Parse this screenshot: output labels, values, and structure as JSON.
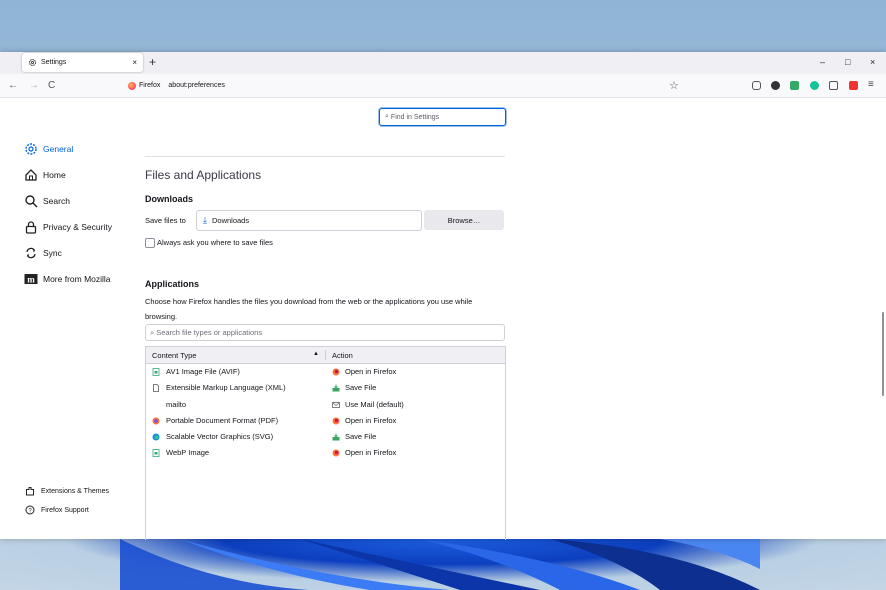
{
  "browser": {
    "tab_title": "Settings",
    "tab_close": "×",
    "new_tab": "+",
    "window_controls": {
      "minimize": "–",
      "maximize": "□",
      "close": "×"
    },
    "nav": {
      "back": "←",
      "forward": "→",
      "reload": "C"
    },
    "url_brand": "Firefox",
    "url": "about:preferences",
    "bookmark_star": "☆",
    "menu": "≡"
  },
  "search": {
    "placeholder": "Find in Settings"
  },
  "sidebar": {
    "items": [
      {
        "label": "General",
        "icon": "gear-icon",
        "active": true
      },
      {
        "label": "Home",
        "icon": "home-icon"
      },
      {
        "label": "Search",
        "icon": "search-icon"
      },
      {
        "label": "Privacy & Security",
        "icon": "lock-icon"
      },
      {
        "label": "Sync",
        "icon": "sync-icon"
      },
      {
        "label": "More from Mozilla",
        "icon": "mozilla-icon"
      }
    ],
    "footer": [
      {
        "label": "Extensions & Themes",
        "icon": "puzzle-icon"
      },
      {
        "label": "Firefox Support",
        "icon": "help-icon"
      }
    ]
  },
  "main": {
    "section_title": "Files and Applications",
    "downloads": {
      "heading": "Downloads",
      "save_label": "Save files to",
      "folder": "Downloads",
      "browse_label": "Browse…",
      "always_ask_label": "Always ask you where to save files",
      "always_ask_checked": false
    },
    "applications": {
      "heading": "Applications",
      "description": "Choose how Firefox handles the files you download from the web or the applications you use while browsing.",
      "search_placeholder": "Search file types or applications",
      "columns": [
        "Content Type",
        "Action"
      ],
      "rows": [
        {
          "type": "AV1 Image File (AVIF)",
          "action": "Open in Firefox"
        },
        {
          "type": "Extensible Markup Language (XML)",
          "action": "Save File"
        },
        {
          "type": "mailto",
          "action": "Use Mail (default)"
        },
        {
          "type": "Portable Document Format (PDF)",
          "action": "Open in Firefox"
        },
        {
          "type": "Scalable Vector Graphics (SVG)",
          "action": "Save File"
        },
        {
          "type": "WebP Image",
          "action": "Open in Firefox"
        }
      ]
    }
  },
  "colors": {
    "accent": "#0061e0",
    "tabbar": "#f0f0f4",
    "button": "#e9e9ed"
  }
}
